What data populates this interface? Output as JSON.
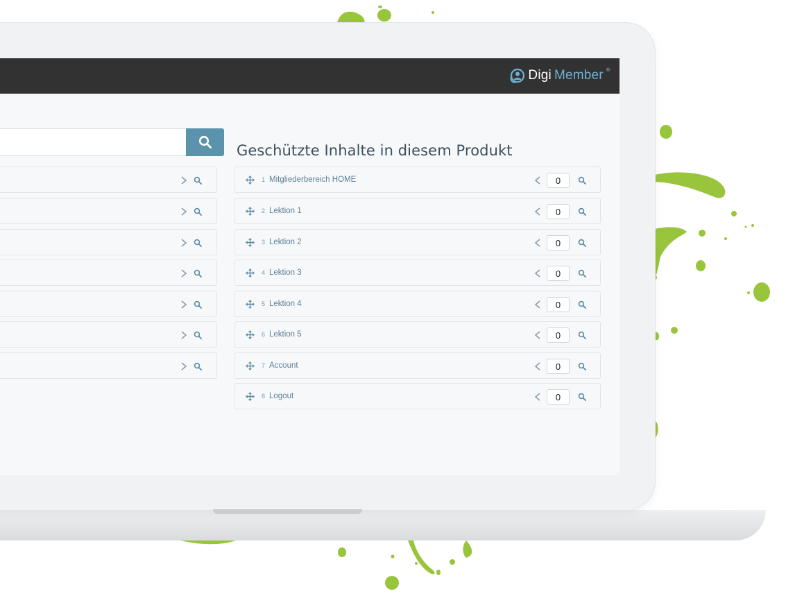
{
  "brand": {
    "name_part1": "Digi",
    "name_part2": "Member",
    "mark": "®",
    "logo_icon": "person-in-circle-icon",
    "accent_color": "#5b93ad",
    "topbar_color": "#323232",
    "splash_color": "#99c53c"
  },
  "search": {
    "placeholder": "",
    "value": "",
    "button_icon": "search-icon"
  },
  "protected": {
    "title": "Geschützte Inhalte in diesem Produkt",
    "items": [
      {
        "num": "1",
        "label": "Mitgliederbereich HOME",
        "order": "0"
      },
      {
        "num": "2",
        "label": "Lektion 1",
        "order": "0"
      },
      {
        "num": "3",
        "label": "Lektion 2",
        "order": "0"
      },
      {
        "num": "4",
        "label": "Lektion 3",
        "order": "0"
      },
      {
        "num": "5",
        "label": "Lektion 4",
        "order": "0"
      },
      {
        "num": "6",
        "label": "Lektion 5",
        "order": "0"
      },
      {
        "num": "7",
        "label": "Account",
        "order": "0"
      },
      {
        "num": "8",
        "label": "Logout",
        "order": "0"
      }
    ]
  },
  "available": {
    "items": [
      {
        "label": ""
      },
      {
        "label": ""
      },
      {
        "label": ""
      },
      {
        "label": ""
      },
      {
        "label": ""
      },
      {
        "label": ""
      },
      {
        "label": ""
      }
    ]
  },
  "icons": {
    "move": "move-arrows-icon",
    "add": "chevron-right-icon",
    "remove": "chevron-left-icon",
    "preview": "search-icon"
  }
}
